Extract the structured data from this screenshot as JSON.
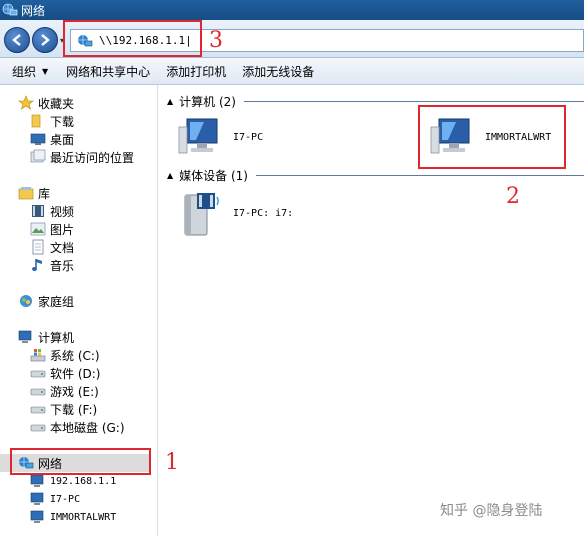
{
  "window": {
    "title": "网络"
  },
  "address": {
    "path": "\\\\192.168.1.1|"
  },
  "toolbar": {
    "organize": "组织",
    "network_center": "网络和共享中心",
    "add_printer": "添加打印机",
    "add_wireless": "添加无线设备"
  },
  "nav": {
    "favorites": "收藏夹",
    "downloads": "下载",
    "desktop": "桌面",
    "recent": "最近访问的位置",
    "libraries": "库",
    "videos": "视频",
    "pictures": "图片",
    "documents": "文档",
    "music": "音乐",
    "homegroup": "家庭组",
    "computer": "计算机",
    "drives": [
      {
        "label": "系统 (C:)"
      },
      {
        "label": "软件 (D:)"
      },
      {
        "label": "游戏 (E:)"
      },
      {
        "label": "下载 (F:)"
      },
      {
        "label": "本地磁盘 (G:)"
      }
    ],
    "network": "网络",
    "network_children": [
      {
        "label": "192.168.1.1"
      },
      {
        "label": "I7-PC"
      },
      {
        "label": "IMMORTALWRT"
      }
    ]
  },
  "content": {
    "computers_header": "计算机 (2)",
    "computers": [
      {
        "label": "I7-PC"
      },
      {
        "label": "IMMORTALWRT"
      }
    ],
    "media_header": "媒体设备 (1)",
    "media": [
      {
        "label": "I7-PC: i7:"
      }
    ]
  },
  "annotations": {
    "n1": "1",
    "n2": "2",
    "n3": "3"
  },
  "watermark": "知乎 @隐身登陆",
  "colors": {
    "annotation": "#e0262e",
    "titlebar": "#1f5f9e"
  }
}
